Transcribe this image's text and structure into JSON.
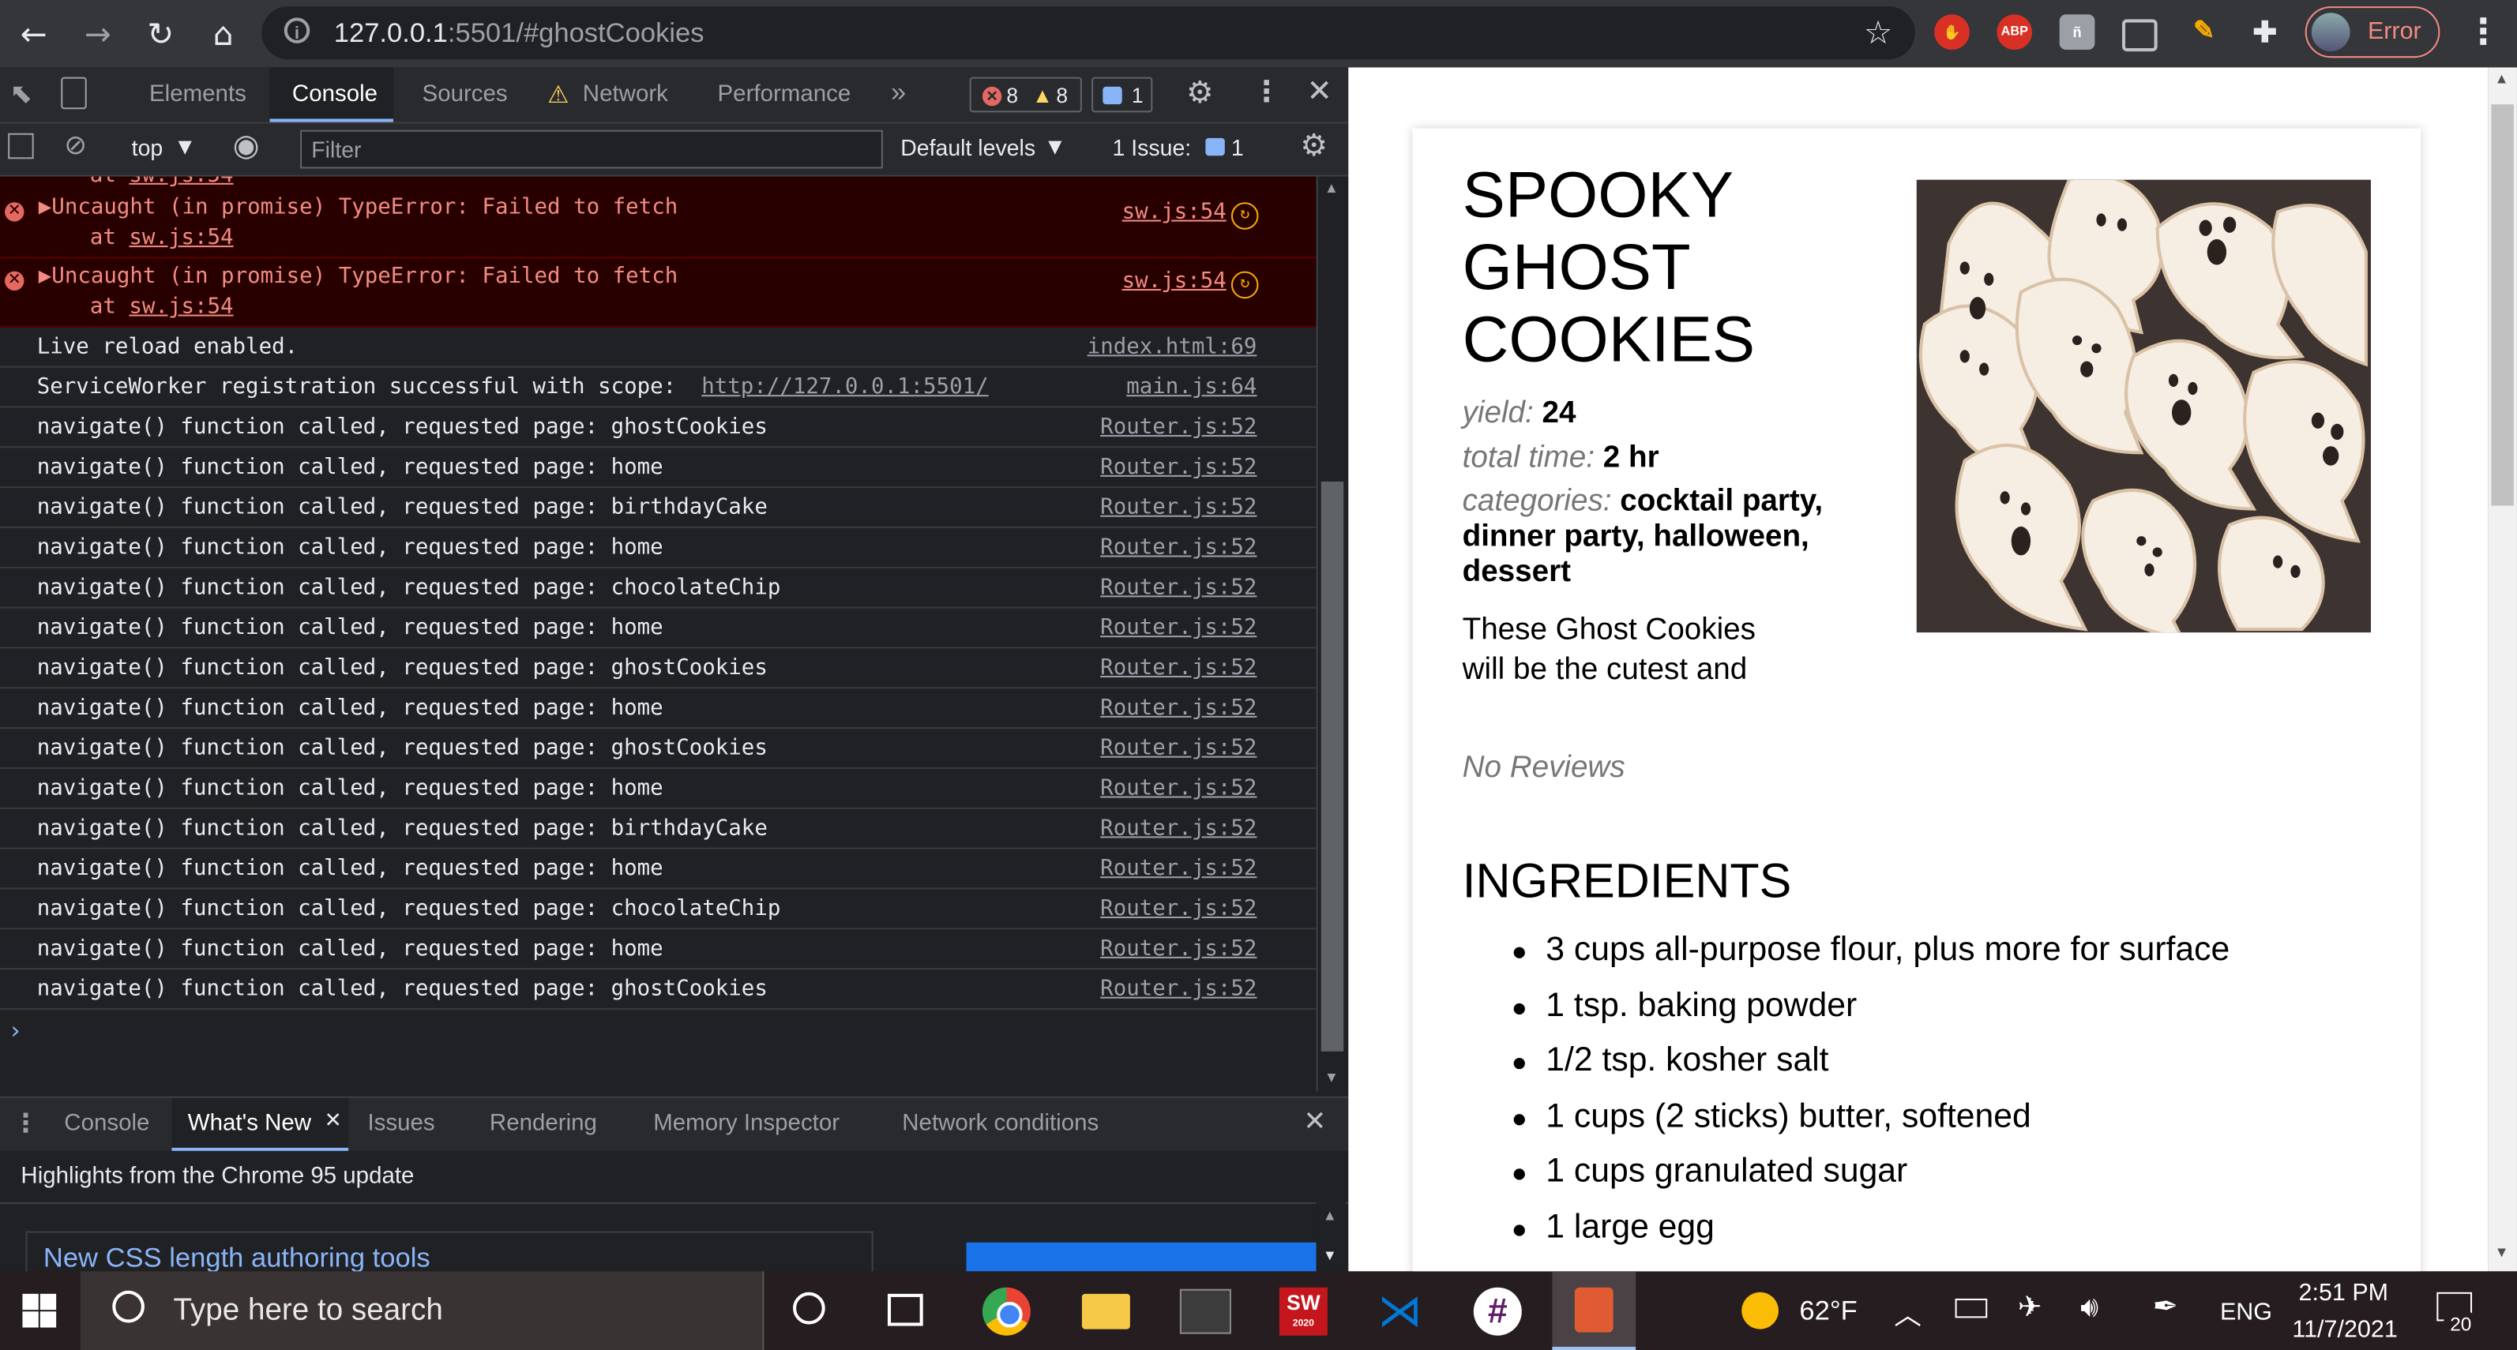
{
  "browser": {
    "url_host": "127.0.0.1",
    "url_rest": ":5501/#ghostCookies",
    "profile_label": "Error",
    "ext_abp": "ABP"
  },
  "devtools": {
    "tabs": [
      "Elements",
      "Console",
      "Sources",
      "Network",
      "Performance"
    ],
    "more": "»",
    "error_count": "8",
    "warning_count": "8",
    "info_count": "1",
    "context": "top",
    "filter_placeholder": "Filter",
    "levels": "Default levels",
    "issues_label": "1 Issue:",
    "issues_count": "1",
    "errors": [
      {
        "msg": "▶Uncaught (in promise) TypeError: Failed to fetch",
        "src": "sw.js:54",
        "at": "at ",
        "at_link": "sw.js:54"
      },
      {
        "msg": "▶Uncaught (in promise) TypeError: Failed to fetch",
        "src": "sw.js:54",
        "at": "at ",
        "at_link": "sw.js:54"
      }
    ],
    "top_at_link": "sw.js:54",
    "logs": [
      {
        "msg": "Live reload enabled.",
        "src": "index.html:69"
      },
      {
        "msg": "ServiceWorker registration successful with scope:  ",
        "link": "http://127.0.0.1:5501/",
        "src": "main.js:64"
      },
      {
        "msg": "navigate() function called, requested page: ghostCookies",
        "src": "Router.js:52"
      },
      {
        "msg": "navigate() function called, requested page: home",
        "src": "Router.js:52"
      },
      {
        "msg": "navigate() function called, requested page: birthdayCake",
        "src": "Router.js:52"
      },
      {
        "msg": "navigate() function called, requested page: home",
        "src": "Router.js:52"
      },
      {
        "msg": "navigate() function called, requested page: chocolateChip",
        "src": "Router.js:52"
      },
      {
        "msg": "navigate() function called, requested page: home",
        "src": "Router.js:52"
      },
      {
        "msg": "navigate() function called, requested page: ghostCookies",
        "src": "Router.js:52"
      },
      {
        "msg": "navigate() function called, requested page: home",
        "src": "Router.js:52"
      },
      {
        "msg": "navigate() function called, requested page: ghostCookies",
        "src": "Router.js:52"
      },
      {
        "msg": "navigate() function called, requested page: home",
        "src": "Router.js:52"
      },
      {
        "msg": "navigate() function called, requested page: birthdayCake",
        "src": "Router.js:52"
      },
      {
        "msg": "navigate() function called, requested page: home",
        "src": "Router.js:52"
      },
      {
        "msg": "navigate() function called, requested page: chocolateChip",
        "src": "Router.js:52"
      },
      {
        "msg": "navigate() function called, requested page: home",
        "src": "Router.js:52"
      },
      {
        "msg": "navigate() function called, requested page: ghostCookies",
        "src": "Router.js:52"
      }
    ],
    "prompt": "›",
    "drawer_tabs": [
      "Console",
      "What's New",
      "Issues",
      "Rendering",
      "Memory Inspector",
      "Network conditions"
    ],
    "whats_new_heading": "Highlights from the Chrome 95 update",
    "whats_new_card": "New CSS length authoring tools"
  },
  "recipe": {
    "title": "SPOOKY GHOST COOKIES",
    "yield_label": "yield:",
    "yield_value": "24",
    "time_label": "total time:",
    "time_value": "2 hr",
    "categories_label": "categories:",
    "categories_value": "cocktail party, dinner party, halloween, dessert",
    "description": "These Ghost Cookies will be the cutest and",
    "reviews": "No Reviews",
    "ingredients_title": "INGREDIENTS",
    "ingredients": [
      "3 cups all-purpose flour, plus more for surface",
      "1 tsp. baking powder",
      "1/2 tsp. kosher salt",
      "1 cups (2 sticks) butter, softened",
      "1 cups granulated sugar",
      "1 large egg"
    ]
  },
  "taskbar": {
    "search_placeholder": "Type here to search",
    "weather": "62°F",
    "language": "ENG",
    "time": "2:51 PM",
    "date": "11/7/2021",
    "notifications": "20",
    "sw_badge": "2020"
  },
  "colors": {
    "error_red": "#f28b82",
    "accent_blue": "#8ab4f8",
    "taskbar": "#251d1f"
  }
}
